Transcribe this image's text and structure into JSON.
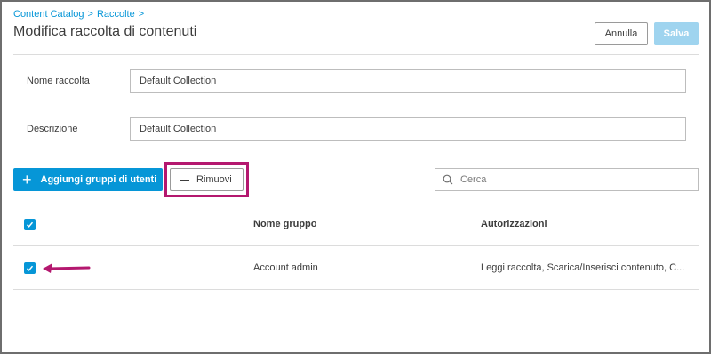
{
  "breadcrumb": {
    "items": [
      "Content Catalog",
      "Raccolte"
    ],
    "separator": ">"
  },
  "page_title": "Modifica raccolta di contenuti",
  "actions": {
    "cancel_label": "Annulla",
    "save_label": "Salva"
  },
  "form": {
    "name_label": "Nome raccolta",
    "name_value": "Default Collection",
    "description_label": "Descrizione",
    "description_value": "Default Collection"
  },
  "toolbar": {
    "add_label": "Aggiungi gruppi di utenti",
    "remove_label": "Rimuovi",
    "search_placeholder": "Cerca"
  },
  "table": {
    "columns": [
      "Nome gruppo",
      "Autorizzazioni"
    ],
    "rows": [
      {
        "group": "Account admin",
        "permissions": "Leggi raccolta, Scarica/Inserisci contenuto, C...",
        "checked": true
      }
    ],
    "select_all_checked": true
  },
  "colors": {
    "accent": "#0696d7",
    "save_disabled": "#9fd4ef",
    "highlight": "#b4186f"
  }
}
